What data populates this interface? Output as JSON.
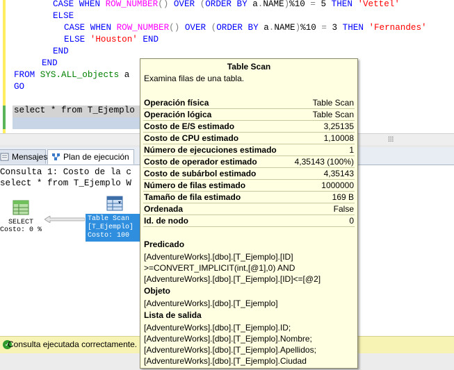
{
  "editor": {
    "lines": [
      {
        "parts": [
          [
            "kw",
            "CASE WHEN "
          ],
          [
            "fn",
            "ROW_NUMBER"
          ],
          [
            "gr",
            "() "
          ],
          [
            "kw",
            "OVER "
          ],
          [
            "gr",
            "("
          ],
          [
            "kw",
            "ORDER BY "
          ],
          [
            "",
            "a"
          ],
          [
            "gr",
            "."
          ],
          [
            "",
            "NAME"
          ],
          [
            "gr",
            ")"
          ],
          [
            "",
            "%10 "
          ],
          [
            "gr",
            "= "
          ],
          [
            "",
            "5 "
          ],
          [
            "kw",
            "THEN "
          ],
          [
            "str",
            "'Vettel'"
          ]
        ]
      },
      {
        "parts": [
          [
            "kw",
            "ELSE"
          ]
        ]
      },
      {
        "parts": [
          [
            "kw",
            "CASE WHEN "
          ],
          [
            "fn",
            "ROW_NUMBER"
          ],
          [
            "gr",
            "() "
          ],
          [
            "kw",
            "OVER "
          ],
          [
            "gr",
            "("
          ],
          [
            "kw",
            "ORDER BY "
          ],
          [
            "",
            "a"
          ],
          [
            "gr",
            "."
          ],
          [
            "",
            "NAME"
          ],
          [
            "gr",
            ")"
          ],
          [
            "",
            "%10 "
          ],
          [
            "gr",
            "= "
          ],
          [
            "",
            "3 "
          ],
          [
            "kw",
            "THEN "
          ],
          [
            "str",
            "'Fernandes'"
          ]
        ]
      },
      {
        "parts": [
          [
            "kw",
            "ELSE "
          ],
          [
            "str",
            "'Houston' "
          ],
          [
            "kw",
            "END"
          ]
        ]
      },
      {
        "parts": [
          [
            "kw",
            "END"
          ]
        ]
      },
      {
        "parts": [
          [
            "kw",
            "END"
          ]
        ]
      },
      {
        "parts": [
          [
            "kw",
            "FROM "
          ],
          [
            "sys",
            "SYS.ALL_objects "
          ],
          [
            "",
            "a"
          ]
        ]
      },
      {
        "parts": [
          [
            "kw",
            "GO"
          ]
        ]
      },
      {
        "parts": []
      },
      {
        "parts": [
          [
            "",
            "select * from T_Ejemplo"
          ]
        ]
      }
    ]
  },
  "tabs": {
    "messages": "Mensajes",
    "plan": "Plan de ejecución"
  },
  "results": {
    "line1": "Consulta 1: Costo de la c",
    "line2": "select * from T_Ejemplo W",
    "select_node": {
      "label": "SELECT",
      "cost": "Costo: 0 %"
    },
    "scan_node": {
      "line1": "Table Scan",
      "line2": "[T_Ejemplo]",
      "line3": "Costo: 100"
    }
  },
  "status": {
    "message": "Consulta ejecutada correctamente."
  },
  "tooltip": {
    "title": "Table Scan",
    "description": "Examina filas de una tabla.",
    "rows": [
      {
        "k": "Operación física",
        "v": "Table Scan"
      },
      {
        "k": "Operación lógica",
        "v": "Table Scan"
      },
      {
        "k": "Costo de E/S estimado",
        "v": "3,25135"
      },
      {
        "k": "Costo de CPU estimado",
        "v": "1,10008"
      },
      {
        "k": "Número de ejecuciones estimado",
        "v": "1"
      },
      {
        "k": "Costo de operador estimado",
        "v": "4,35143 (100%)"
      },
      {
        "k": "Costo de subárbol estimado",
        "v": "4,35143"
      },
      {
        "k": "Número de filas estimado",
        "v": "1000000"
      },
      {
        "k": "Tamaño de fila estimado",
        "v": "169 B"
      },
      {
        "k": "Ordenada",
        "v": "False"
      },
      {
        "k": "Id. de nodo",
        "v": "0"
      }
    ],
    "predicate_title": "Predicado",
    "predicate_lines": [
      "[AdventureWorks].[dbo].[T_Ejemplo].[ID]",
      ">=CONVERT_IMPLICIT(int,[@1],0) AND",
      "[AdventureWorks].[dbo].[T_Ejemplo].[ID]<=[@2]"
    ],
    "object_title": "Objeto",
    "object_line": "[AdventureWorks].[dbo].[T_Ejemplo]",
    "output_title": "Lista de salida",
    "output_lines": [
      "[AdventureWorks].[dbo].[T_Ejemplo].ID;",
      "[AdventureWorks].[dbo].[T_Ejemplo].Nombre;",
      "[AdventureWorks].[dbo].[T_Ejemplo].Apellidos;",
      "[AdventureWorks].[dbo].[T_Ejemplo].Ciudad"
    ]
  }
}
